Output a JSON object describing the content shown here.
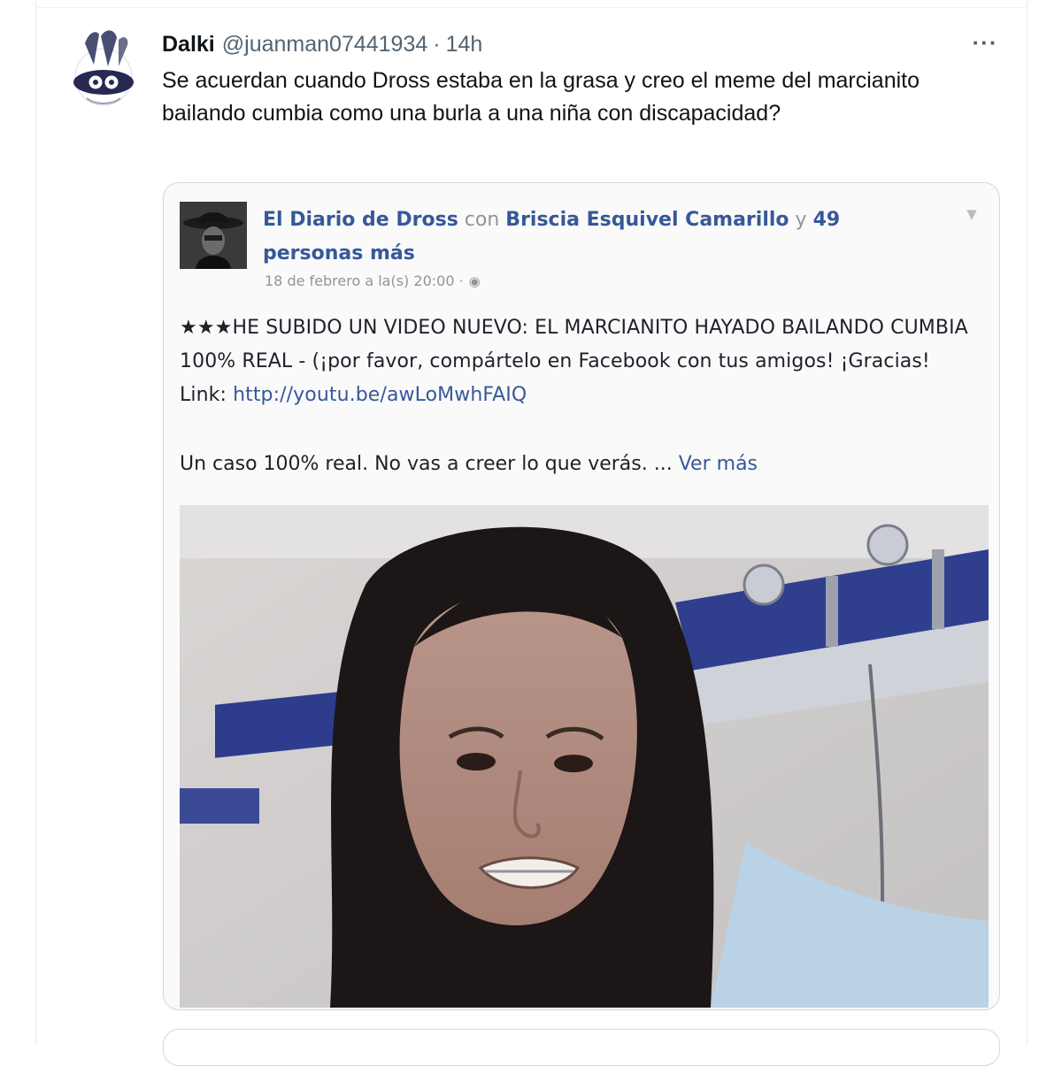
{
  "tweet": {
    "author_name": "Dalki",
    "author_handle": "@juanman07441934",
    "separator": "·",
    "time": "14h",
    "more_label": "···",
    "text": "Se acuerdan cuando Dross estaba en la grasa y creo el meme del marcianito bailando cumbia como una burla a una niña con discapacidad?"
  },
  "quoted_post": {
    "page_name": "El Diario de Dross",
    "with_word": "con",
    "tagged_person": "Briscia Esquivel Camarillo",
    "and_word": "y",
    "others": "49 personas más",
    "date": "18 de febrero a la(s) 20:00 ·",
    "body_line1": "★★★HE SUBIDO UN VIDEO NUEVO: EL MARCIANITO HAYADO BAILANDO CUMBIA 100% REAL - (¡por favor, compártelo en Facebook con tus amigos! ¡Gracias!",
    "link_label": "Link:",
    "link_url": "http://youtu.be/awLoMwhFAIQ",
    "summary": "Un caso 100% real. No vas a creer lo que verás. ...",
    "see_more": "Ver más"
  },
  "colors": {
    "text_primary": "#0f1419",
    "text_secondary": "#536471",
    "fb_blue": "#365899",
    "fb_gray": "#90949c",
    "border": "#cfd9de"
  }
}
